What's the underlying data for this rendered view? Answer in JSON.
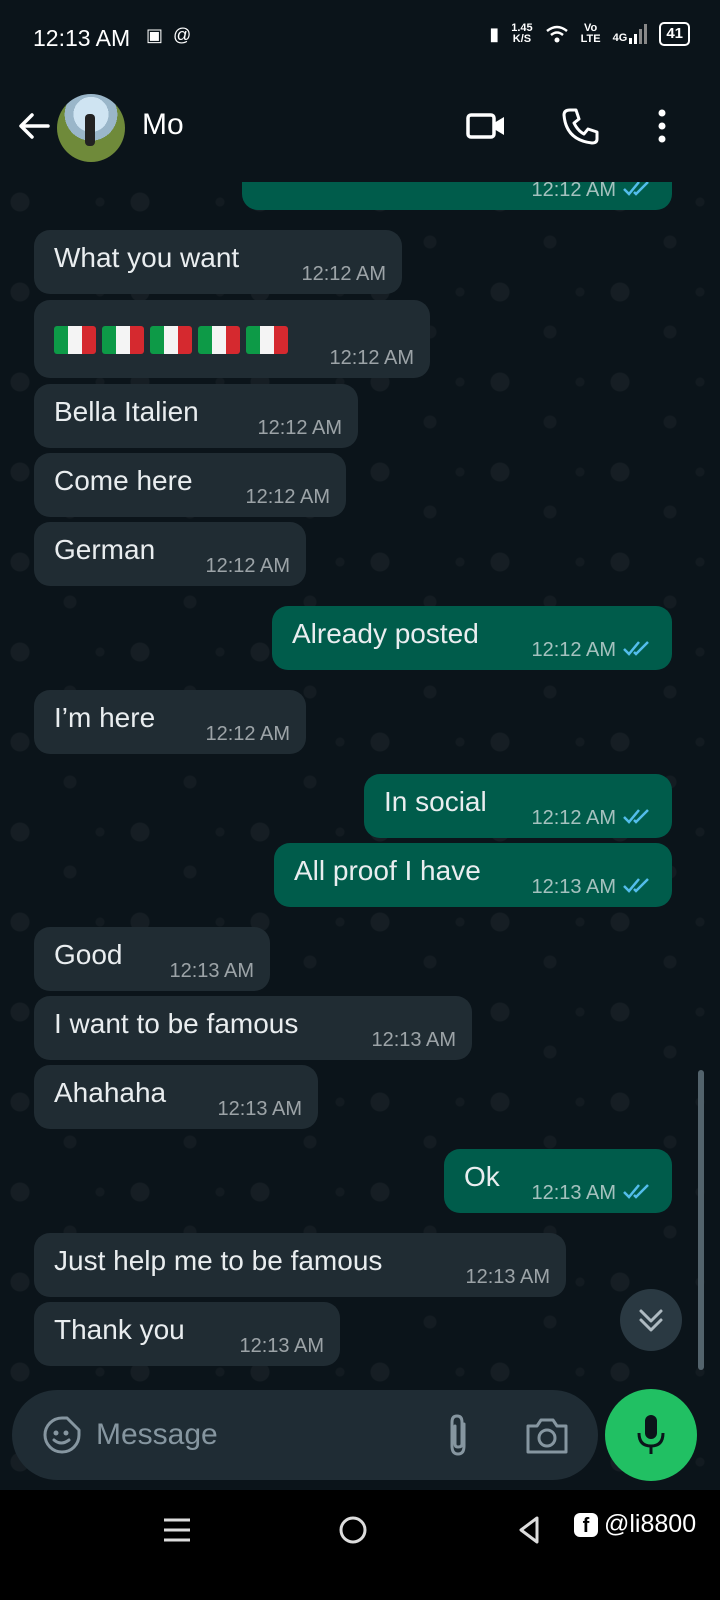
{
  "status_bar": {
    "time": "12:13 AM",
    "net_speed_value": "1.45",
    "net_speed_unit": "K/S",
    "volte_top": "Vo",
    "volte_bottom": "LTE",
    "network": "4G",
    "battery": "41"
  },
  "header": {
    "contact_name": "Mo"
  },
  "messages": [
    {
      "dir": "out",
      "text": "",
      "time": "12:12 AM",
      "read": true
    },
    {
      "dir": "in",
      "text": "What you want",
      "time": "12:12 AM"
    },
    {
      "dir": "in",
      "text": "🇮🇹🇮🇹🇮🇹🇮🇹🇮🇹",
      "time": "12:12 AM"
    },
    {
      "dir": "in",
      "text": "Bella Italien",
      "time": "12:12 AM"
    },
    {
      "dir": "in",
      "text": "Come here",
      "time": "12:12 AM"
    },
    {
      "dir": "in",
      "text": "German",
      "time": "12:12 AM"
    },
    {
      "dir": "out",
      "text": "Already posted",
      "time": "12:12 AM",
      "read": true
    },
    {
      "dir": "in",
      "text": "I’m here",
      "time": "12:12 AM"
    },
    {
      "dir": "out",
      "text": "In social",
      "time": "12:12 AM",
      "read": true
    },
    {
      "dir": "out",
      "text": "All proof I have",
      "time": "12:13 AM",
      "read": true
    },
    {
      "dir": "in",
      "text": "Good",
      "time": "12:13 AM"
    },
    {
      "dir": "in",
      "text": "I want to be famous",
      "time": "12:13 AM"
    },
    {
      "dir": "in",
      "text": "Ahahaha",
      "time": "12:13 AM"
    },
    {
      "dir": "out",
      "text": "Ok",
      "time": "12:13 AM",
      "read": true
    },
    {
      "dir": "in",
      "text": "Just help me to be famous",
      "time": "12:13 AM"
    },
    {
      "dir": "in",
      "text": "Thank you",
      "time": "12:13 AM"
    }
  ],
  "composer": {
    "placeholder": "Message"
  },
  "watermark": {
    "handle": "@li8800"
  },
  "colors": {
    "incoming_bubble": "#202c33",
    "outgoing_bubble": "#005c4b",
    "read_ticks": "#53bdeb",
    "mic_button": "#21c063"
  }
}
